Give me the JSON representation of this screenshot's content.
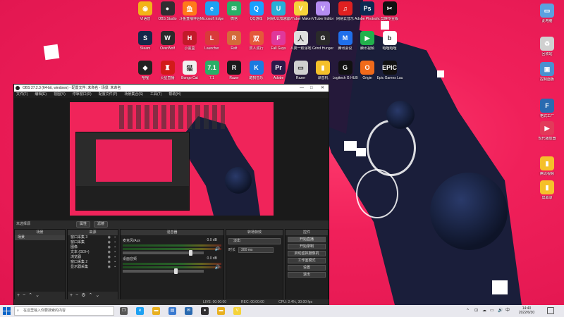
{
  "desktop": {
    "grid_icons": [
      {
        "label": "VI语音",
        "color": "#f2b418",
        "glyph": "◉"
      },
      {
        "label": "OBS Studio",
        "color": "#302e31",
        "glyph": "●"
      },
      {
        "label": "斗鱼直播伴侣",
        "color": "#ff7a1a",
        "glyph": "鱼"
      },
      {
        "label": "Microsoft Edge",
        "color": "#1da1f2",
        "glyph": "e"
      },
      {
        "label": "微信",
        "color": "#2aae67",
        "glyph": "✉"
      },
      {
        "label": "QQ游戏",
        "color": "#1aa0ff",
        "glyph": "Q"
      },
      {
        "label": "网易UU加速器",
        "color": "#26b0d8",
        "glyph": "U"
      },
      {
        "label": "VTuber Maker",
        "color": "#f5d33a",
        "glyph": "V"
      },
      {
        "label": "VTuber Editor",
        "color": "#b48cf2",
        "glyph": "V"
      },
      {
        "label": "网易云音乐",
        "color": "#e02020",
        "glyph": "♫"
      },
      {
        "label": "Adobe Photoshop",
        "color": "#0b2a52",
        "glyph": "Ps"
      },
      {
        "label": "剪映专业版",
        "color": "#111111",
        "glyph": "✂"
      },
      {
        "label": "Steam",
        "color": "#15284a",
        "glyph": "S"
      },
      {
        "label": "OverWolf",
        "color": "#2a2a2a",
        "glyph": "W"
      },
      {
        "label": "小黑盒",
        "color": "#c21a2a",
        "glyph": "H"
      },
      {
        "label": "Launcher",
        "color": "#d83a3a",
        "glyph": "L"
      },
      {
        "label": "Raft",
        "color": "#d46a3a",
        "glyph": "R"
      },
      {
        "label": "双人成行",
        "color": "#e4583a",
        "glyph": "双"
      },
      {
        "label": "Fall Guys",
        "color": "#e0389a",
        "glyph": "F"
      },
      {
        "label": "人类一败涂地",
        "color": "#dedede",
        "glyph": "人"
      },
      {
        "label": "Grind Hunger",
        "color": "#2a2a2a",
        "glyph": "G"
      },
      {
        "label": "腾讯会议",
        "color": "#1f6feb",
        "glyph": "M"
      },
      {
        "label": "腾讯视频",
        "color": "#22b14c",
        "glyph": "▶"
      },
      {
        "label": "哈哩哈哩",
        "color": "#ffffff",
        "glyph": "b"
      },
      {
        "label": "哈哩",
        "color": "#222222",
        "glyph": "◆"
      },
      {
        "label": "火星直播",
        "color": "#d21a1a",
        "glyph": "♜"
      },
      {
        "label": "Bongo Cat",
        "color": "#f0f0f0",
        "glyph": "猫"
      },
      {
        "label": "7.1",
        "color": "#2aae67",
        "glyph": "7.1"
      },
      {
        "label": "Razer",
        "color": "#1a1a1a",
        "glyph": "R"
      },
      {
        "label": "酷狗音乐",
        "color": "#1a7ae0",
        "glyph": "K"
      },
      {
        "label": "Adobe",
        "color": "#2a1a4a",
        "glyph": "Pr"
      },
      {
        "label": "Razer",
        "color": "#cfcfcf",
        "glyph": "▭"
      },
      {
        "label": "录音机",
        "color": "#f5c02a",
        "glyph": "▮"
      },
      {
        "label": "Logitech G HUB",
        "color": "#111111",
        "glyph": "G"
      },
      {
        "label": "Origin",
        "color": "#f06a1a",
        "glyph": "O"
      },
      {
        "label": "Epic Games Launcher",
        "color": "#111111",
        "glyph": "EPIC"
      }
    ],
    "right_icons": [
      {
        "label": "此电脑",
        "color": "#5aa0e0",
        "glyph": "▭"
      },
      {
        "label": "回收站",
        "color": "#d0d0d0",
        "glyph": "♻"
      },
      {
        "label": "控制面板",
        "color": "#4a90d0",
        "glyph": "▣"
      },
      {
        "label": "格式工厂",
        "color": "#2a6ab0",
        "glyph": "F"
      },
      {
        "label": "现代播放器",
        "color": "#e23a5a",
        "glyph": "▶"
      },
      {
        "label": "腾讯视频",
        "color": "#f5c02a",
        "glyph": "▮"
      },
      {
        "label": "屏幕录",
        "color": "#f5c02a",
        "glyph": "▮"
      }
    ]
  },
  "obs": {
    "title": "OBS 27.2.3 (64-bit, windows) - 配置文件: 未命名 - 场景: 未命名",
    "menu": [
      "文件(F)",
      "编辑(E)",
      "视图(V)",
      "停靠窗口(D)",
      "配置文件(P)",
      "场景集合(S)",
      "工具(T)",
      "帮助(H)"
    ],
    "source_bar": {
      "label": "未选择源",
      "btn1": "属性",
      "btn2": "滤镜"
    },
    "scenes": {
      "header": "场景",
      "items": [
        "场景"
      ]
    },
    "sources": {
      "header": "来源",
      "items": [
        "窗口采集 3",
        "窗口采集",
        "图像",
        "文本 (GDI+)",
        "浏览器",
        "窗口采集 2",
        "显示器采集"
      ]
    },
    "mixer": {
      "header": "混音器",
      "channels": [
        {
          "name": "麦克风/Aux",
          "value": "0.0 dB",
          "level": 0.82
        },
        {
          "name": "桌面音频",
          "value": "0.0 dB",
          "level": 0.64
        }
      ]
    },
    "transitions": {
      "header": "转场特效",
      "selected": "淡出",
      "duration_label": "时长",
      "duration_value": "300 ms"
    },
    "controls": {
      "header": "控件",
      "buttons": [
        "开始直播",
        "开始录制",
        "启动虚拟摄像机",
        "工作室模式",
        "设置",
        "退出"
      ]
    },
    "status": {
      "live": "LIVE: 00:00:00",
      "rec": "REC: 00:00:00",
      "cpu": "CPU: 2.4%, 30.00 fps"
    },
    "window_controls": {
      "minimize": "—",
      "maximize": "□",
      "close": "✕"
    }
  },
  "taskbar": {
    "search_placeholder": "在这里输入你要搜索的内容",
    "time": "14:40",
    "date": "2022/6/30",
    "pinned": [
      {
        "name": "task-view",
        "color": "#555555",
        "glyph": "❐"
      },
      {
        "name": "edge",
        "color": "#1da1f2",
        "glyph": "e"
      },
      {
        "name": "explorer",
        "color": "#e8b020",
        "glyph": "▬"
      },
      {
        "name": "store",
        "color": "#3a7ad0",
        "glyph": "▤"
      },
      {
        "name": "mail",
        "color": "#2a6ab0",
        "glyph": "✉"
      },
      {
        "name": "obs",
        "color": "#302e31",
        "glyph": "●"
      },
      {
        "name": "folder",
        "color": "#e8b020",
        "glyph": "▬"
      },
      {
        "name": "vtuber",
        "color": "#f5d33a",
        "glyph": "V"
      }
    ],
    "tray": [
      "^",
      "⊡",
      "☁",
      "▭",
      "🔊",
      "中"
    ]
  }
}
